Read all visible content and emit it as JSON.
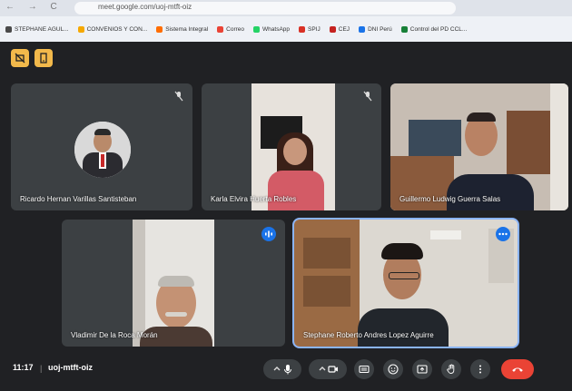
{
  "browser": {
    "url": "meet.google.com/uoj-mtft-oiz",
    "bookmarks": [
      {
        "label": "STEPHANE AGUL...",
        "color": "#4a4a4a"
      },
      {
        "label": "CONVENIOS Y CON...",
        "color": "#f6a800"
      },
      {
        "label": "Sistema Integral",
        "color": "#ff6d00"
      },
      {
        "label": "Correo",
        "color": "#ea4335"
      },
      {
        "label": "WhatsApp",
        "color": "#25d366"
      },
      {
        "label": "SPIJ",
        "color": "#d93025"
      },
      {
        "label": "CEJ",
        "color": "#c5221f"
      },
      {
        "label": "DNI Perú",
        "color": "#1a73e8"
      },
      {
        "label": "Control del PD CCL...",
        "color": "#188038"
      }
    ]
  },
  "meet": {
    "participants": [
      {
        "name": "Ricardo Hernan Varillas Santisteban"
      },
      {
        "name": "Karla Elvira Huerta Robles"
      },
      {
        "name": "Guillermo Ludwig Guerra Salas"
      },
      {
        "name": "Vladimir De la Roca Morán"
      },
      {
        "name": "Stephane Roberto Andres Lopez Aguirre"
      }
    ],
    "time": "11:17",
    "separator": "|",
    "meeting_code": "uoj-mtft-oiz",
    "colors": {
      "accent": "#8ab4f8",
      "end_call": "#ea4335",
      "mini_button": "#f2b94b"
    }
  }
}
